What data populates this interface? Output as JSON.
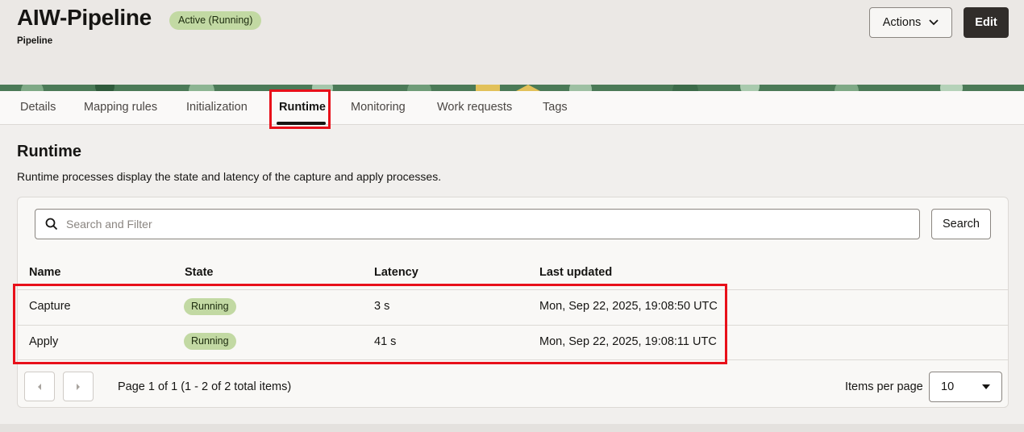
{
  "header": {
    "title": "AIW-Pipeline",
    "status": "Active (Running)",
    "subtitle": "Pipeline",
    "actions_label": "Actions",
    "edit_label": "Edit"
  },
  "tabs": [
    {
      "label": "Details"
    },
    {
      "label": "Mapping rules"
    },
    {
      "label": "Initialization"
    },
    {
      "label": "Runtime",
      "active": true
    },
    {
      "label": "Monitoring"
    },
    {
      "label": "Work requests"
    },
    {
      "label": "Tags"
    }
  ],
  "section": {
    "title": "Runtime",
    "description": "Runtime processes display the state and latency of the capture and apply processes."
  },
  "search": {
    "placeholder": "Search and Filter",
    "button_label": "Search"
  },
  "table": {
    "columns": [
      "Name",
      "State",
      "Latency",
      "Last updated"
    ],
    "rows": [
      {
        "name": "Capture",
        "state": "Running",
        "latency": "3 s",
        "last_updated": "Mon, Sep 22, 2025, 19:08:50 UTC"
      },
      {
        "name": "Apply",
        "state": "Running",
        "latency": "41 s",
        "last_updated": "Mon, Sep 22, 2025, 19:08:11 UTC"
      }
    ]
  },
  "pagination": {
    "summary": "Page 1 of 1 (1 - 2 of 2 total items)",
    "items_per_page_label": "Items per page",
    "items_per_page_value": "10"
  },
  "colors": {
    "highlight": "#e8101a",
    "status_green": "#c2d9a3",
    "edit_dark": "#312d2a"
  }
}
